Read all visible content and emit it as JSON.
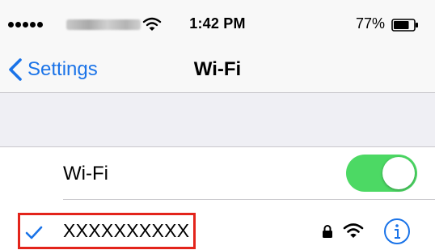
{
  "status_bar": {
    "time": "1:42 PM",
    "battery_percent": "77%",
    "battery_level": 0.77,
    "signal_bars": 5,
    "icons": [
      "signal-dots-icon",
      "wifi-icon",
      "battery-icon"
    ]
  },
  "nav": {
    "back_label": "Settings",
    "title": "Wi-Fi",
    "back_icon": "chevron-left-icon"
  },
  "wifi_toggle": {
    "label": "Wi-Fi",
    "state": "on"
  },
  "network": {
    "name": "XXXXXXXXXX",
    "connected": true,
    "icons": [
      "checkmark-icon",
      "lock-icon",
      "wifi-icon",
      "info-icon"
    ]
  },
  "colors": {
    "accent": "#1a73e8",
    "toggle_on": "#4cd964",
    "highlight": "#e3241b",
    "background_band": "#efeff4"
  }
}
